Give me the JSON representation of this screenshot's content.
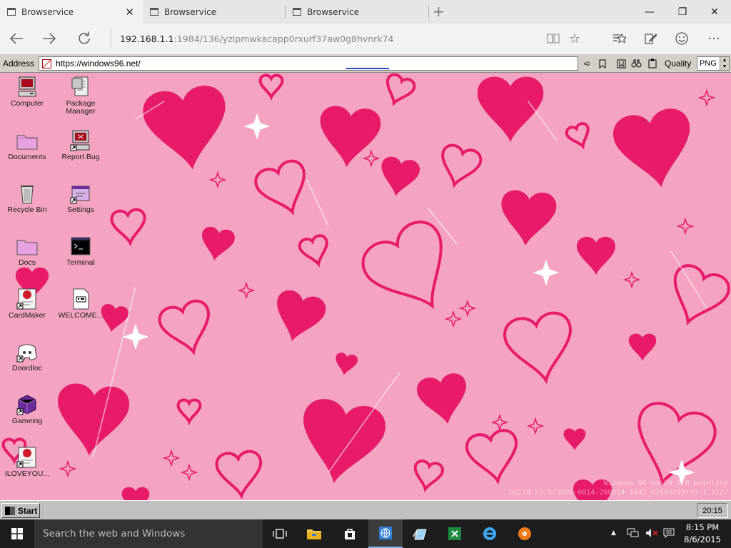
{
  "tabs": [
    {
      "title": "Browservice"
    },
    {
      "title": "Browservice"
    },
    {
      "title": "Browservice"
    }
  ],
  "edge": {
    "url_host": "192.168.1.1",
    "url_rest": ":1984/136/yzlpmwkacapp0rxurf37aw0g8hvnrk74"
  },
  "browservice": {
    "address_label": "Address",
    "address_value": "https://windows96.net/",
    "quality_label": "Quality",
    "quality_value": "PNG"
  },
  "desktop_icons": [
    {
      "label": "Computer",
      "icon": "computer-icon"
    },
    {
      "label": "Package Manager",
      "icon": "package-icon"
    },
    {
      "label": "Documents",
      "icon": "folder-icon"
    },
    {
      "label": "Report Bug",
      "icon": "report-bug-icon"
    },
    {
      "label": "Recycle Bin",
      "icon": "recycle-bin-icon"
    },
    {
      "label": "Settings",
      "icon": "settings-icon"
    },
    {
      "label": "Docs",
      "icon": "folder-icon"
    },
    {
      "label": "Terminal",
      "icon": "terminal-icon"
    },
    {
      "label": "CardMaker",
      "icon": "cardmaker-icon"
    },
    {
      "label": "WELCOME...",
      "icon": "text-document-icon"
    },
    {
      "label": "Doordloc",
      "icon": "discord-icon"
    },
    {
      "label": "Gameing",
      "icon": "game-cube-icon"
    },
    {
      "label": "ILOVEYOU...",
      "icon": "cardmaker-icon"
    }
  ],
  "watermark": {
    "line1": "Windows 96 build 2.0 mainline",
    "line2": "bu11d 23/3/2000-0014-200214-1442_0260ac93f35-7.1127"
  },
  "w96_taskbar": {
    "start_label": "Start",
    "clock": "20:15"
  },
  "win10_taskbar": {
    "search_placeholder": "Search the web and Windows",
    "time": "8:15 PM",
    "date": "8/6/2015"
  },
  "colors": {
    "wallpaper_bg": "#f4a4c2",
    "heart": "#e81b6b",
    "w96_chrome": "#c0c0c0",
    "win10_taskbar": "#1d1d1d"
  }
}
